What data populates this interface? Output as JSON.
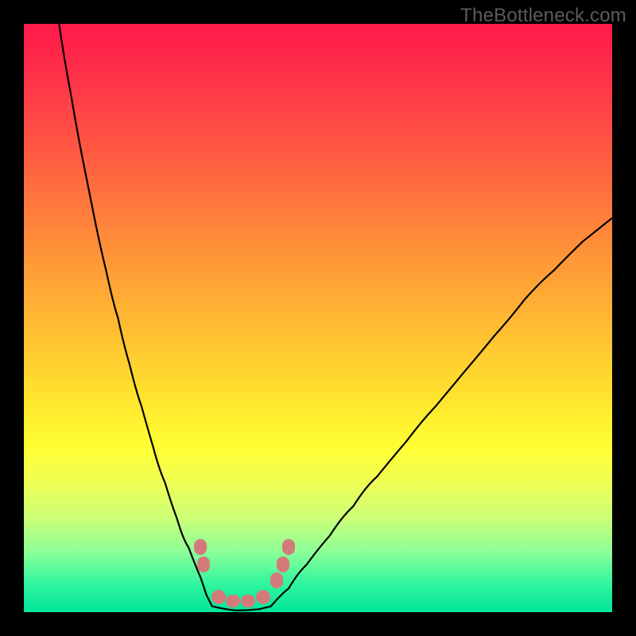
{
  "watermark": "TheBottleneck.com",
  "chart_data": {
    "type": "line",
    "title": "",
    "xlabel": "",
    "ylabel": "",
    "xlim": [
      0,
      100
    ],
    "ylim": [
      0,
      100
    ],
    "grid": false,
    "legend": false,
    "background_gradient": {
      "orientation": "vertical",
      "stops": [
        {
          "pos": 0.0,
          "color": "#ff1a4b"
        },
        {
          "pos": 0.08,
          "color": "#ff2f4a"
        },
        {
          "pos": 0.22,
          "color": "#ff5a42"
        },
        {
          "pos": 0.36,
          "color": "#ff8a3a"
        },
        {
          "pos": 0.5,
          "color": "#ffb733"
        },
        {
          "pos": 0.63,
          "color": "#ffe22e"
        },
        {
          "pos": 0.72,
          "color": "#ffff33"
        },
        {
          "pos": 0.78,
          "color": "#eeff55"
        },
        {
          "pos": 0.84,
          "color": "#ccff77"
        },
        {
          "pos": 0.9,
          "color": "#88ff99"
        },
        {
          "pos": 0.95,
          "color": "#33f59f"
        },
        {
          "pos": 1.0,
          "color": "#00e69a"
        }
      ]
    },
    "series": [
      {
        "name": "left-branch",
        "x": [
          6,
          8,
          10,
          12,
          14,
          16,
          18,
          20,
          22,
          24,
          26,
          28,
          30,
          31,
          32
        ],
        "y": [
          100,
          88,
          77,
          67,
          58,
          50,
          42,
          35,
          28,
          22,
          16,
          11,
          6,
          3,
          1
        ]
      },
      {
        "name": "valley-floor",
        "x": [
          32,
          34,
          36,
          38,
          40,
          42
        ],
        "y": [
          1,
          0.5,
          0.3,
          0.3,
          0.5,
          1
        ]
      },
      {
        "name": "right-branch",
        "x": [
          42,
          45,
          48,
          52,
          56,
          60,
          65,
          70,
          75,
          80,
          85,
          90,
          95,
          100
        ],
        "y": [
          1,
          4,
          8,
          13,
          18,
          23,
          29,
          35,
          41,
          47,
          53,
          58,
          63,
          67
        ]
      }
    ],
    "markers": [
      {
        "name": "left-marker-upper",
        "x": 30.0,
        "y": 11,
        "color": "#d57a7a"
      },
      {
        "name": "left-marker-lower",
        "x": 30.5,
        "y": 8,
        "color": "#d57a7a"
      },
      {
        "name": "floor-marker-1",
        "x": 33.0,
        "y": 2,
        "color": "#d57a7a"
      },
      {
        "name": "floor-marker-2",
        "x": 35.5,
        "y": 1.5,
        "color": "#d57a7a"
      },
      {
        "name": "floor-marker-3",
        "x": 38.0,
        "y": 1.5,
        "color": "#d57a7a"
      },
      {
        "name": "floor-marker-4",
        "x": 40.5,
        "y": 2,
        "color": "#d57a7a"
      },
      {
        "name": "right-marker-lower",
        "x": 43.0,
        "y": 5,
        "color": "#d57a7a"
      },
      {
        "name": "right-marker-mid",
        "x": 44.0,
        "y": 8,
        "color": "#d57a7a"
      },
      {
        "name": "right-marker-upper",
        "x": 45.0,
        "y": 11,
        "color": "#d57a7a"
      }
    ]
  }
}
